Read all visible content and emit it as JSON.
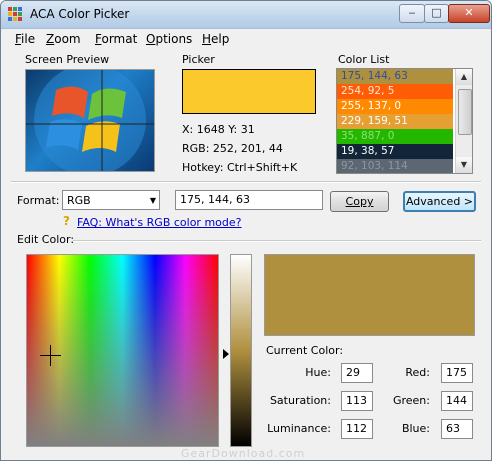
{
  "window": {
    "title": "ACA Color Picker"
  },
  "menu": [
    {
      "accel": "F",
      "rest": "ile"
    },
    {
      "accel": "Z",
      "rest": "oom"
    },
    {
      "accel": "F",
      "rest": "ormat",
      "pre": ""
    },
    {
      "accel": "O",
      "rest": "ptions"
    },
    {
      "accel": "H",
      "rest": "elp"
    }
  ],
  "sections": {
    "screen_preview": "Screen Preview",
    "picker": "Picker",
    "color_list": "Color List",
    "edit_color": "Edit Color:"
  },
  "picker": {
    "color": "#fcc92c",
    "coords": "X: 1648 Y: 31",
    "rgb": "RGB: 252, 201, 44",
    "hotkey": "Hotkey: Ctrl+Shift+K"
  },
  "color_list": [
    {
      "text": "175, 144, 63",
      "bg": "#af903f",
      "fg": "#2f4f9f"
    },
    {
      "text": "254, 92, 5",
      "bg": "#fe5c05",
      "fg": "#ffe7d0"
    },
    {
      "text": "255, 137, 0",
      "bg": "#ff8900",
      "fg": "#ffffff"
    },
    {
      "text": "229, 159, 51",
      "bg": "#e59f33",
      "fg": "#ffffff"
    },
    {
      "text": "35, 887, 0",
      "bg": "#23b700",
      "fg": "#8ee07a"
    },
    {
      "text": "19, 38, 57",
      "bg": "#132639",
      "fg": "#ffffff"
    },
    {
      "text": "92, 103, 114",
      "bg": "#5c6772",
      "fg": "#8a96a2"
    }
  ],
  "format": {
    "label": "Format:",
    "selected": "RGB",
    "value": "175, 144, 63",
    "copy": "Copy",
    "advanced": "Advanced >",
    "faq": "FAQ: What's RGB color mode?"
  },
  "current": {
    "label": "Current Color:",
    "color": "#af903f",
    "hue_label": "Hue:",
    "hue": "29",
    "sat_label": "Saturation:",
    "sat": "113",
    "lum_label": "Luminance:",
    "lum": "112",
    "red_label": "Red:",
    "red": "175",
    "green_label": "Green:",
    "green": "144",
    "blue_label": "Blue:",
    "blue": "63"
  },
  "watermark": "GearDownload.com"
}
